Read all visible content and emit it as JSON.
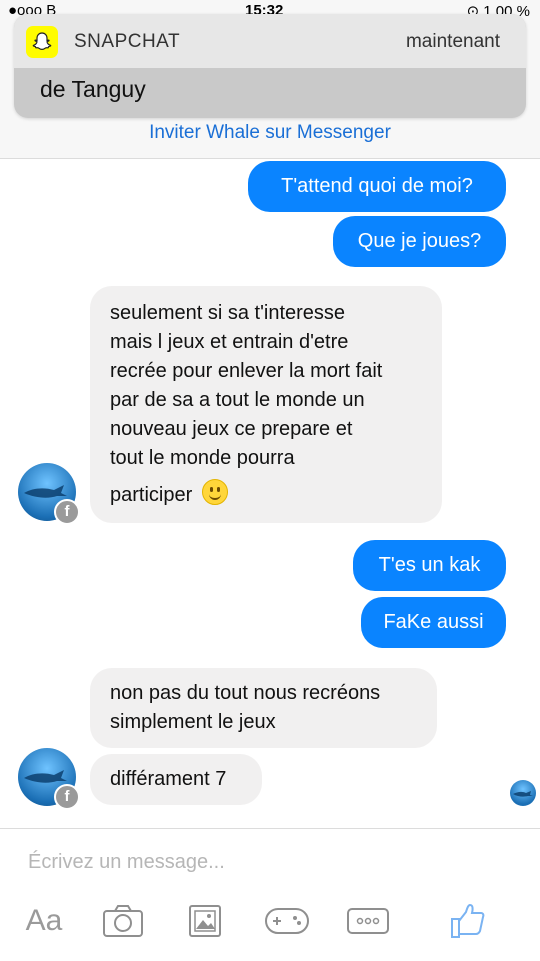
{
  "status_bar": {
    "left": "●ooo B",
    "time": "15:32",
    "right": "⊙  1 00 %"
  },
  "notification": {
    "app": "SNAPCHAT",
    "time": "maintenant",
    "message": "de Tanguy"
  },
  "invite": "Inviter Whale sur Messenger",
  "messages": {
    "out1": "T'attend quoi de moi?",
    "out2": "Que je joues?",
    "in1_lines": [
      "seulement si sa t'interesse",
      "mais l jeux et entrain d'etre",
      "recrée pour enlever la mort fait",
      "par de sa a tout le monde un",
      "nouveau jeux ce prepare et",
      "tout le monde pourra",
      "participer"
    ],
    "out3": "T'es un kak",
    "out4": "FaKe aussi",
    "in2_lines": [
      "non pas du tout nous recréons",
      "simplement le jeux"
    ],
    "in3": "différament 7"
  },
  "composer": {
    "placeholder": "Écrivez un message...",
    "aa_label": "Aa"
  },
  "colors": {
    "outgoing": "#0a84ff",
    "incoming": "#f1f0f0",
    "link": "#1a6fd6",
    "snapchat_yellow": "#fffc00"
  },
  "icons": [
    "camera-icon",
    "gallery-icon",
    "game-controller-icon",
    "more-icon",
    "thumbs-up-icon"
  ]
}
